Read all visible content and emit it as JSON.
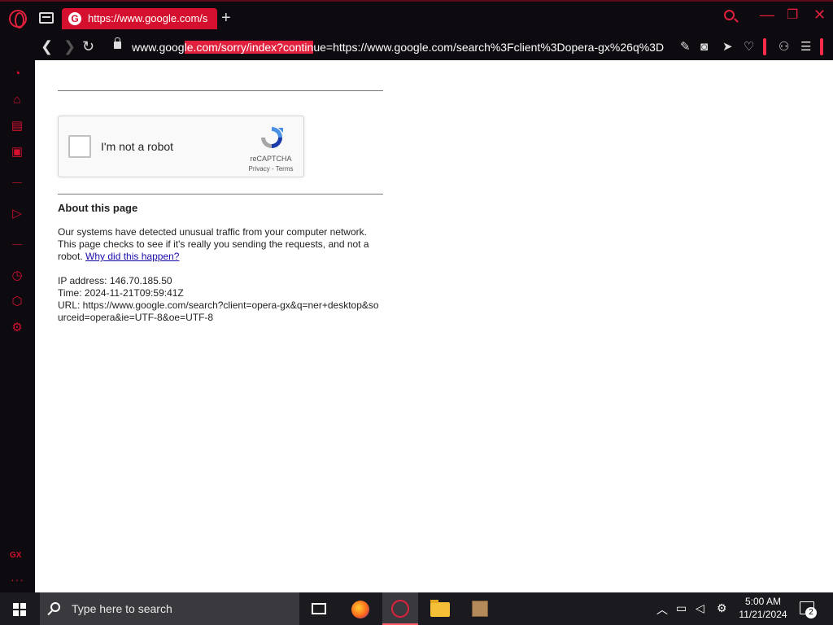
{
  "browser": {
    "tab": {
      "title": "https://www.google.com/s"
    },
    "address_bar": {
      "url_before": "www.goog",
      "url_selected": "le.com/sorry/index?contin",
      "url_after": "ue=https://www.google.com/search%3Fclient%3Dopera-gx%26q%3D"
    }
  },
  "captcha": {
    "label": "I'm not a robot",
    "brand": "reCAPTCHA",
    "terms": "Privacy - Terms"
  },
  "about": {
    "heading": "About this page",
    "message": "Our systems have detected unusual traffic from your computer network. This page checks to see if it's really you sending the requests, and not a robot.",
    "link": "Why did this happen?",
    "ip": "IP address: 146.70.185.50",
    "time": "Time: 2024-11-21T09:59:41Z",
    "url": "URL: https://www.google.com/search?client=opera-gx&q=ner+desktop&sourceid=opera&ie=UTF-8&oe=UTF-8"
  },
  "sidebar": {
    "gx_label": "GX"
  },
  "taskbar": {
    "search_placeholder": "Type here to search",
    "time": "5:00 AM",
    "date": "11/21/2024",
    "notifications": "2"
  },
  "colors": {
    "accent": "#e0203c",
    "chrome_bg": "#0d0a10",
    "link": "#1a0dab"
  }
}
